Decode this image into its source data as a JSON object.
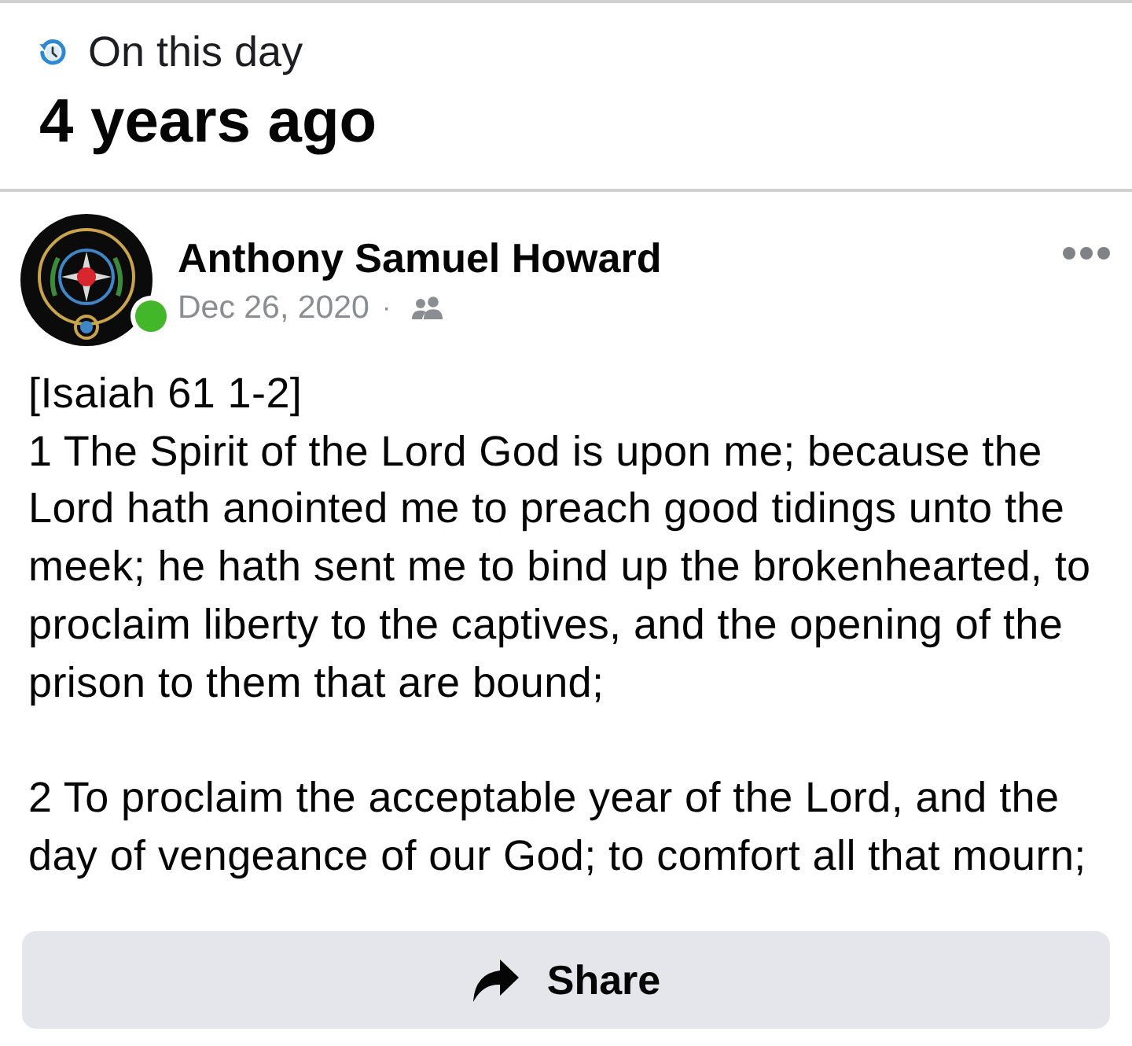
{
  "header": {
    "label": "On this day",
    "title": "4 years ago"
  },
  "post": {
    "author": "Anthony Samuel Howard",
    "online": true,
    "date": "Dec 26, 2020",
    "separator": "·",
    "paragraphs": [
      "[Isaiah 61 1-2]\n1 The Spirit of the Lord God is upon me; because the Lord hath anointed me to preach good tidings unto the meek; he hath sent me to bind up the brokenhearted, to proclaim liberty to the captives, and the opening of the prison to them that are bound;",
      "2 To proclaim the acceptable year of the Lord, and the day of vengeance of our God; to comfort all that mourn;"
    ]
  },
  "share_button": {
    "label": "Share"
  }
}
